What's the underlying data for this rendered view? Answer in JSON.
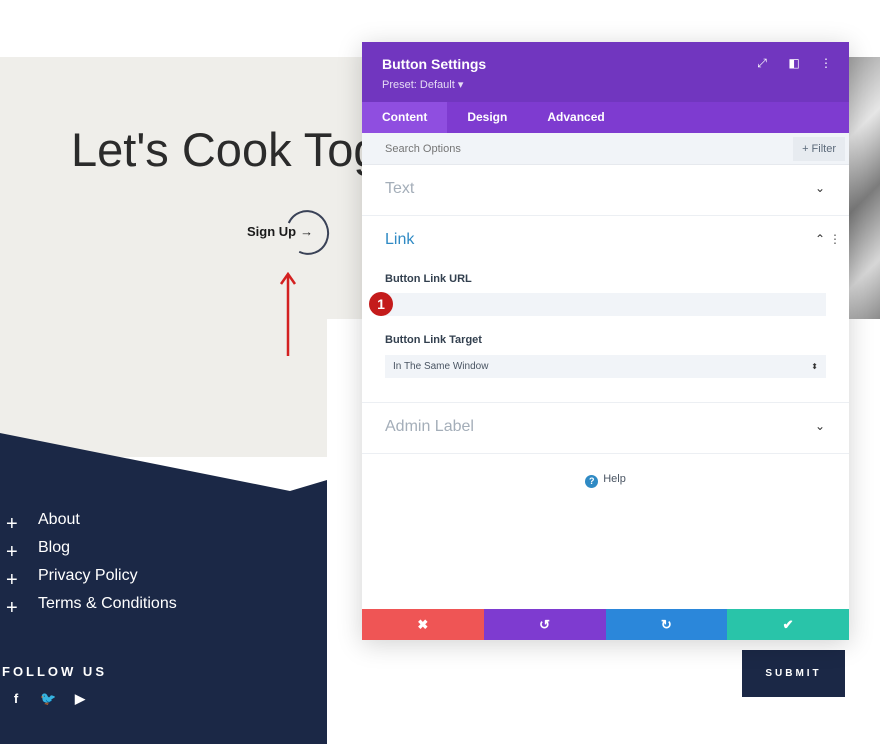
{
  "page": {
    "hero_title": "Let's Cook Tog",
    "signup_label": "Sign Up",
    "signup_arrow": "→",
    "footer_links": [
      {
        "plus": "+",
        "label": "About"
      },
      {
        "plus": "+",
        "label": "Blog"
      },
      {
        "plus": "+",
        "label": "Privacy Policy"
      },
      {
        "plus": "+",
        "label": "Terms & Conditions"
      }
    ],
    "follow_label": "FOLLOW US",
    "socials": [
      {
        "icon": "facebook-icon",
        "glyph": "f"
      },
      {
        "icon": "twitter-icon",
        "glyph": "🐦"
      },
      {
        "icon": "youtube-icon",
        "glyph": "▶"
      }
    ],
    "submit_label": "SUBMIT"
  },
  "modal": {
    "title": "Button Settings",
    "preset": "Preset: Default ▾",
    "header_icons": [
      "⤢",
      "◧",
      "⋮"
    ],
    "tabs": [
      "Content",
      "Design",
      "Advanced"
    ],
    "active_tab": "Content",
    "search_placeholder": "Search Options",
    "filter_label": "+ Filter",
    "sections": {
      "text": {
        "title": "Text",
        "chevron": "⌄"
      },
      "link": {
        "title": "Link",
        "chevron": "⌃",
        "kebab": "⋮",
        "url_label": "Button Link URL",
        "url_value": "",
        "target_label": "Button Link Target",
        "target_value": "In The Same Window",
        "select_arrows": "⬍"
      },
      "admin": {
        "title": "Admin Label",
        "chevron": "⌄"
      }
    },
    "badge": "1",
    "help_icon": "?",
    "help_label": "Help",
    "footer": {
      "close": "✖",
      "undo": "↺",
      "redo": "↻",
      "save": "✔"
    }
  },
  "colors": {
    "modal_header": "#7136bf",
    "tab_bar": "#7e3bd0",
    "navy": "#1b2846",
    "link_blue": "#2f8ac4",
    "badge_red": "#c41b1b"
  }
}
